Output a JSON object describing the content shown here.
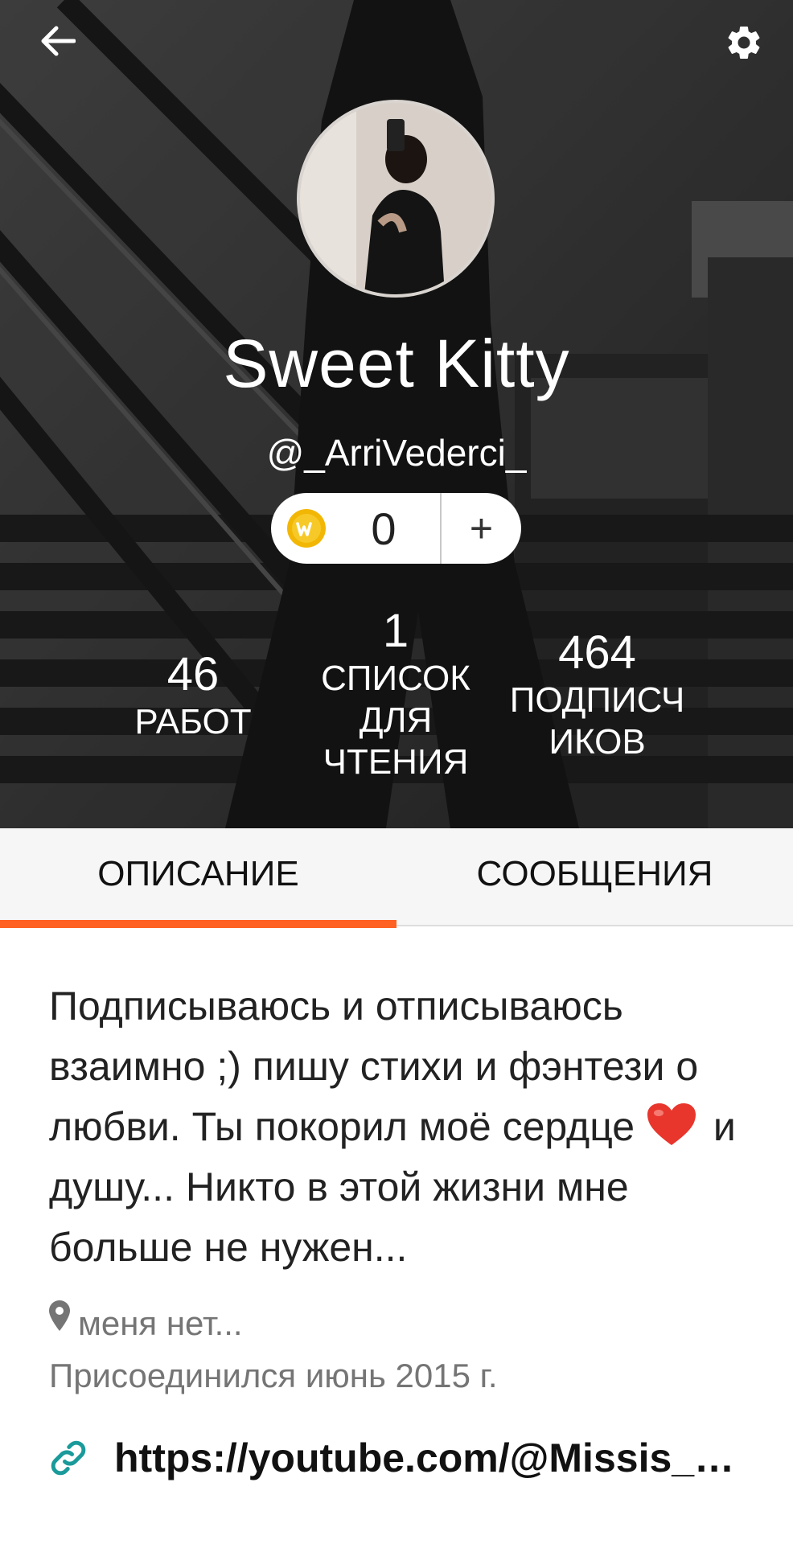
{
  "profile": {
    "display_name": "Sweet Kitty",
    "username": "@_ArriVederci_"
  },
  "coins": {
    "count": "0",
    "add_label": "+"
  },
  "stats": {
    "works": {
      "value": "46",
      "label": "РАБОТ"
    },
    "reading_lists": {
      "value": "1",
      "label_lines": [
        "СПИСОК",
        "ДЛЯ",
        "ЧТЕНИЯ"
      ]
    },
    "followers": {
      "value": "464",
      "label_lines": [
        "ПОДПИСЧ",
        "ИКОВ"
      ]
    }
  },
  "tabs": [
    {
      "label": "ОПИСАНИЕ",
      "active": true
    },
    {
      "label": "СООБЩЕНИЯ",
      "active": false
    }
  ],
  "about": {
    "description_before": "Подписываюсь и отписываюсь взаимно ;) пишу стихи и фэнтези о любви. Ты покорил моё сердце",
    "description_after": "и душу... Никто в этой жизни мне больше не нужен...",
    "location": "меня нет...",
    "joined": "Присоединился июнь 2015 г.",
    "link": "https://youtube.com/@Missis_…"
  },
  "colors": {
    "accent": "#ff6122",
    "link_icon": "#1a9a9a",
    "coin": "#f2b705"
  },
  "icons": {
    "back": "arrow-left-icon",
    "settings": "gear-icon",
    "coin": "wattpad-coin-icon",
    "location": "map-pin-icon",
    "link": "link-icon",
    "heart": "red-heart-emoji"
  }
}
